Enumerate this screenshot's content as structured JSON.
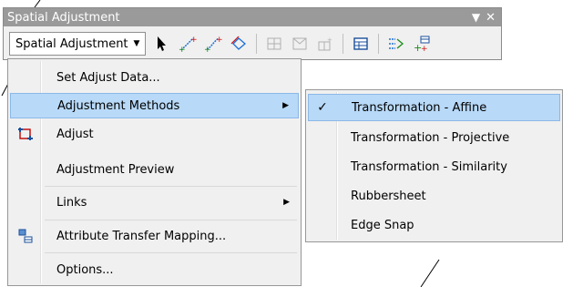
{
  "toolbar": {
    "title": "Spatial Adjustment",
    "dropdown_label": "Spatial Adjustment",
    "icons": [
      "select-elements-icon",
      "new-displacement-link-icon",
      "modify-link-icon",
      "multiple-displacement-links-icon",
      "new-identity-link-icon",
      "new-limited-adjustment-area-icon",
      "clear-limited-adjustment-area-icon",
      "view-link-table-icon",
      "attribute-transfer-tool-icon",
      "paste-attributes-icon"
    ]
  },
  "menu": {
    "items": [
      {
        "label": "Set Adjust Data..."
      },
      {
        "label": "Adjustment Methods"
      },
      {
        "label": "Adjust"
      },
      {
        "label": "Adjustment Preview"
      },
      {
        "label": "Links"
      },
      {
        "label": "Attribute Transfer Mapping..."
      },
      {
        "label": "Options..."
      }
    ]
  },
  "submenu": {
    "items": [
      {
        "label": "Transformation - Affine",
        "checked": true
      },
      {
        "label": "Transformation - Projective"
      },
      {
        "label": "Transformation - Similarity"
      },
      {
        "label": "Rubbersheet"
      },
      {
        "label": "Edge Snap"
      }
    ]
  },
  "colors": {
    "highlight": "#b8d9f8",
    "highlight_border": "#8cb8e8",
    "title_bar": "#9a9a9a",
    "menu_bg": "#f0f0f0"
  }
}
